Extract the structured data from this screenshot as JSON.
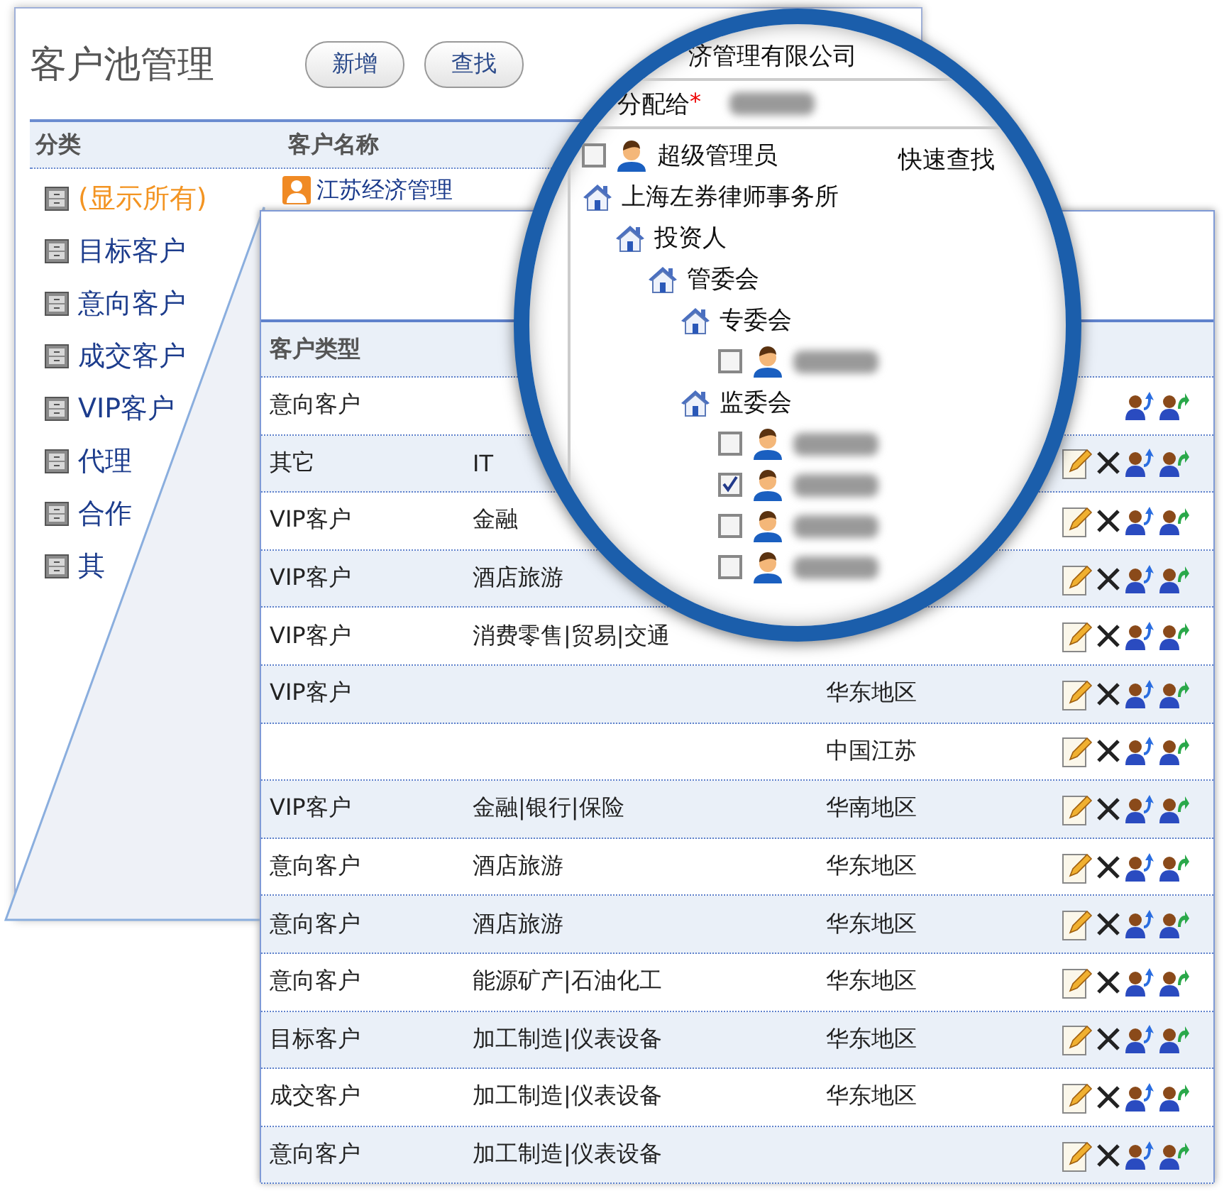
{
  "back_panel": {
    "title": "客户池管理",
    "buttons": [
      "新增",
      "查找"
    ],
    "columns": [
      "分类",
      "客户名称"
    ],
    "categories": [
      {
        "label": "(显示所有)",
        "selected": true
      },
      {
        "label": "目标客户",
        "selected": false
      },
      {
        "label": "意向客户",
        "selected": false
      },
      {
        "label": "成交客户",
        "selected": false
      },
      {
        "label": "VIP客户",
        "selected": false
      },
      {
        "label": "代理",
        "selected": false
      },
      {
        "label": "合作",
        "selected": false
      },
      {
        "label": "其",
        "selected": false
      }
    ],
    "customers": [
      "江苏经济管理"
    ]
  },
  "front_panel": {
    "columns": [
      "客户类型"
    ],
    "rows": [
      {
        "type": "意向客户",
        "partly_covered": true
      },
      {
        "type": "其它",
        "industry": "IT"
      },
      {
        "type": "VIP客户",
        "industry": "金融"
      },
      {
        "type": "VIP客户",
        "industry": "酒店旅游"
      },
      {
        "type": "VIP客户",
        "industry": "消费零售|贸易|交通"
      },
      {
        "type": "VIP客户",
        "region": "华东地区"
      },
      {
        "region": "中国江苏"
      },
      {
        "type": "VIP客户",
        "industry": "金融|银行|保险",
        "region": "华南地区"
      },
      {
        "type": "意向客户",
        "industry": "酒店旅游",
        "region": "华东地区"
      },
      {
        "type": "意向客户",
        "industry": "酒店旅游",
        "region": "华东地区"
      },
      {
        "type": "意向客户",
        "industry": "能源矿产|石油化工",
        "region": "华东地区"
      },
      {
        "type": "目标客户",
        "industry": "加工制造|仪表设备",
        "region": "华东地区"
      },
      {
        "type": "成交客户",
        "industry": "加工制造|仪表设备",
        "region": "华东地区"
      },
      {
        "type": "意向客户",
        "industry": "加工制造|仪表设备"
      }
    ]
  },
  "lens": {
    "company": "济管理有限公司",
    "assign_label": "分配给",
    "required_mark": "*",
    "quick_search": "快速查找",
    "tree": [
      {
        "kind": "user",
        "label": "超级管理员",
        "checked": false
      },
      {
        "kind": "org",
        "label": "上海左券律师事务所",
        "children": [
          {
            "kind": "org",
            "label": "投资人",
            "children": [
              {
                "kind": "org",
                "label": "管委会",
                "children": [
                  {
                    "kind": "org",
                    "label": "专委会",
                    "children": [
                      {
                        "kind": "user",
                        "checked": false
                      }
                    ]
                  },
                  {
                    "kind": "org",
                    "label": "监委会",
                    "children": [
                      {
                        "kind": "user",
                        "checked": false
                      },
                      {
                        "kind": "user",
                        "checked": true
                      },
                      {
                        "kind": "user",
                        "checked": false
                      },
                      {
                        "kind": "user",
                        "checked": false
                      }
                    ]
                  }
                ]
              }
            ]
          }
        ]
      }
    ]
  }
}
